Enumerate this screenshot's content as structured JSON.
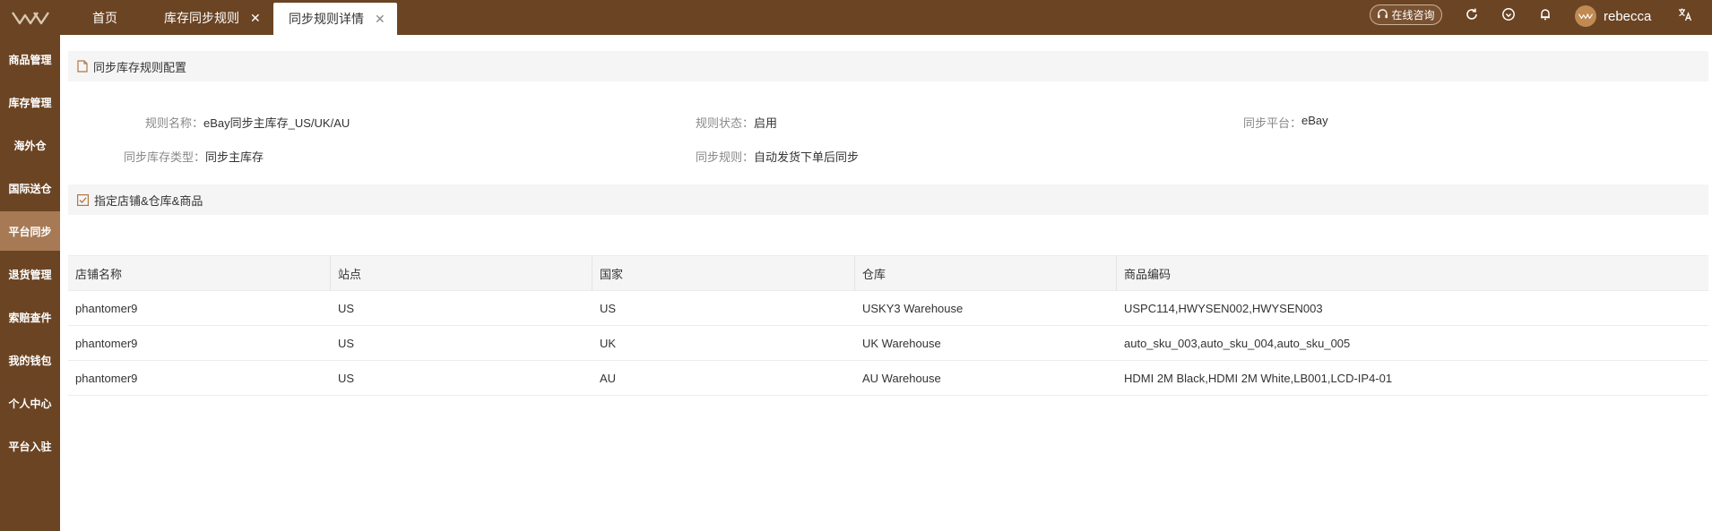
{
  "header": {
    "tabs": [
      {
        "label": "首页",
        "closable": false,
        "active": false
      },
      {
        "label": "库存同步规则",
        "closable": true,
        "active": false
      },
      {
        "label": "同步规则详情",
        "closable": true,
        "active": true
      }
    ],
    "consult_label": "在线咨询",
    "username": "rebecca",
    "icons": [
      "refresh-icon",
      "heart-shield-icon",
      "bell-icon",
      "translate-icon"
    ]
  },
  "sidebar": {
    "items": [
      {
        "label": "商品管理",
        "active": false
      },
      {
        "label": "库存管理",
        "active": false
      },
      {
        "label": "海外仓",
        "active": false
      },
      {
        "label": "国际送仓",
        "active": false
      },
      {
        "label": "平台同步",
        "active": true
      },
      {
        "label": "退货管理",
        "active": false
      },
      {
        "label": "索赔查件",
        "active": false
      },
      {
        "label": "我的钱包",
        "active": false
      },
      {
        "label": "个人中心",
        "active": false
      },
      {
        "label": "平台入驻",
        "active": false
      }
    ]
  },
  "config_section": {
    "title": "同步库存规则配置",
    "fields": {
      "rule_name_label": "规则名称：",
      "rule_name_value": "eBay同步主库存_US/UK/AU",
      "rule_status_label": "规则状态：",
      "rule_status_value": "启用",
      "platform_label": "同步平台：",
      "platform_value": "eBay",
      "stock_type_label": "同步库存类型：",
      "stock_type_value": "同步主库存",
      "sync_rule_label": "同步规则：",
      "sync_rule_value": "自动发货下单后同步"
    }
  },
  "assign_section": {
    "title": "指定店铺&仓库&商品"
  },
  "table": {
    "columns": [
      "店铺名称",
      "站点",
      "国家",
      "仓库",
      "商品编码"
    ],
    "rows": [
      [
        "phantomer9",
        "US",
        "US",
        "USKY3 Warehouse",
        "USPC114,HWYSEN002,HWYSEN003"
      ],
      [
        "phantomer9",
        "US",
        "UK",
        "UK Warehouse",
        "auto_sku_003,auto_sku_004,auto_sku_005"
      ],
      [
        "phantomer9",
        "US",
        "AU",
        "AU Warehouse",
        "HDMI 2M Black,HDMI 2M White,LB001,LCD-IP4-01"
      ]
    ]
  },
  "colors": {
    "brand": "#6b4423",
    "sidebar_active": "#a77a55",
    "accent": "#b07844"
  }
}
